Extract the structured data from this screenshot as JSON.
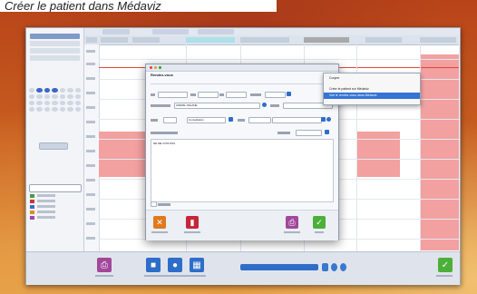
{
  "caption": "Créer le patient dans Médaviz",
  "context_menu": {
    "items": [
      {
        "label": "Couper"
      },
      {
        "label": "Créer le patient sur Médaviz"
      },
      {
        "label": "Voir le rendez-vous dans Médaviz"
      }
    ]
  },
  "dialog": {
    "title": "Rendez-vous",
    "patient_name": "ANDRE JOHANE",
    "type_value": "Consultation",
    "comment": "NE ME VOIS PAS"
  },
  "colors": {
    "appointment": "#f3a0a0",
    "accent": "#2e6ec9",
    "print": "#a3479a",
    "save": "#4caf3a",
    "cancel": "#e07a1e",
    "delete": "#c6263a"
  }
}
